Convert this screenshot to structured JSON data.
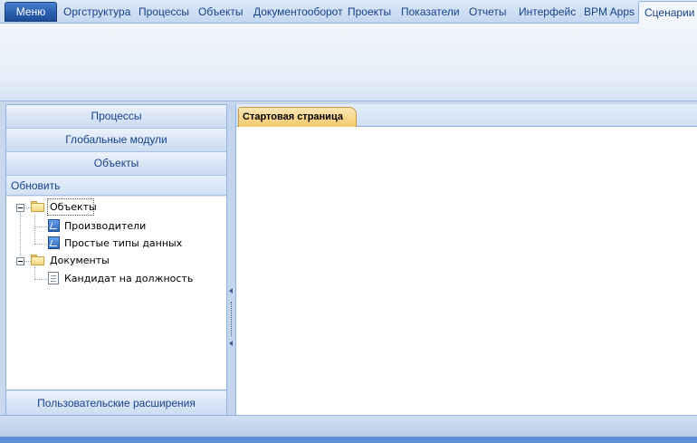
{
  "menu_button": "Меню",
  "ribbon_tabs": [
    {
      "label": "Оргструктура"
    },
    {
      "label": "Процессы"
    },
    {
      "label": "Объекты"
    },
    {
      "label": "Документооборот"
    },
    {
      "label": "Проекты"
    },
    {
      "label": "Показатели"
    },
    {
      "label": "Отчеты"
    },
    {
      "label": "Интерфейс"
    },
    {
      "label": "BPM Apps"
    },
    {
      "label": "Сценарии",
      "active": true
    }
  ],
  "left_panel": {
    "nav_buttons": [
      "Процессы",
      "Глобальные модули",
      "Объекты"
    ],
    "refresh_label": "Обновить",
    "tree": [
      {
        "label": "Объекты",
        "type": "folder",
        "expanded": true,
        "selected": true,
        "children": [
          {
            "label": "Производители",
            "type": "object"
          },
          {
            "label": "Простые типы данных",
            "type": "object"
          }
        ]
      },
      {
        "label": "Документы",
        "type": "folder",
        "expanded": true,
        "children": [
          {
            "label": "Кандидат на должность",
            "type": "document"
          }
        ]
      }
    ],
    "extensions_button": "Пользовательские расширения"
  },
  "document_area": {
    "tabs": [
      {
        "label": "Стартовая страница",
        "active": true
      }
    ]
  },
  "colors": {
    "accent": "#15428b",
    "menu_button": "#2a5fae",
    "active_doc_tab": "#f6c96b"
  }
}
